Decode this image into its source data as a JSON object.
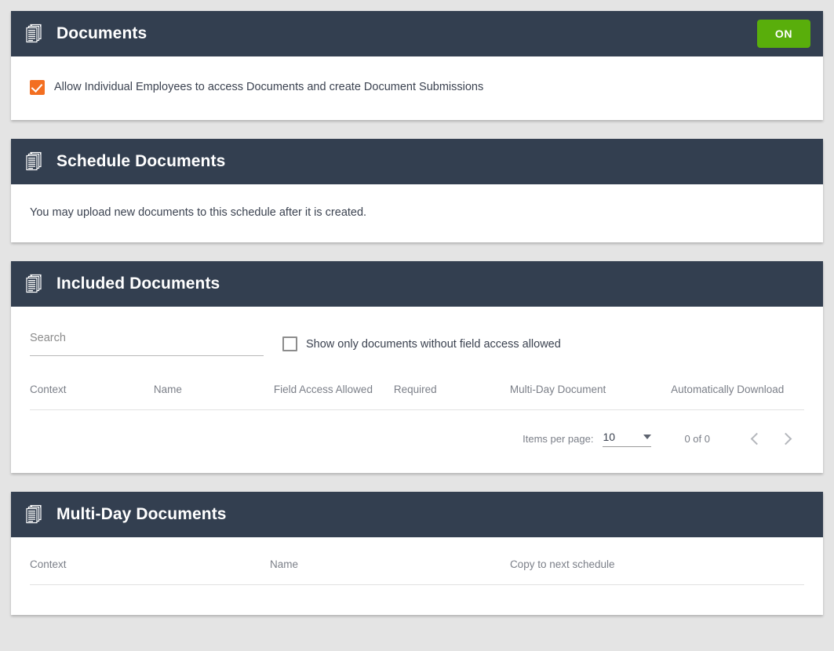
{
  "theme": {
    "header_bg": "#333f50",
    "page_bg": "#e4e4e4",
    "toggle_green": "#59ae0b",
    "checkbox_orange": "#f36f21",
    "text_color": "#3b4250",
    "muted_text": "#7b7f88"
  },
  "documents_section": {
    "icon": "documents-stack-icon",
    "title": "Documents",
    "toggle_label": "ON",
    "toggle_state": "on",
    "checkbox": {
      "checked": true,
      "label": "Allow Individual Employees to access Documents and create Document Submissions"
    }
  },
  "schedule_section": {
    "icon": "documents-stack-icon",
    "title": "Schedule Documents",
    "message": "You may upload new documents to this schedule after it is created."
  },
  "included_section": {
    "icon": "documents-stack-icon",
    "title": "Included Documents",
    "search": {
      "placeholder": "Search",
      "value": ""
    },
    "filter_checkbox": {
      "checked": false,
      "label": "Show only documents without field access allowed"
    },
    "table": {
      "columns": [
        "Context",
        "Name",
        "Field Access Allowed",
        "Required",
        "Multi-Day Document",
        "Automatically Download"
      ],
      "rows": []
    },
    "paginator": {
      "items_per_page_label": "Items per page:",
      "items_per_page_value": "10",
      "range_label": "0 of 0",
      "prev_icon": "chevron-left-icon",
      "next_icon": "chevron-right-icon"
    }
  },
  "multiday_section": {
    "icon": "documents-stack-icon",
    "title": "Multi-Day Documents",
    "table": {
      "columns": [
        "Context",
        "Name",
        "Copy to next schedule"
      ],
      "rows": []
    }
  }
}
